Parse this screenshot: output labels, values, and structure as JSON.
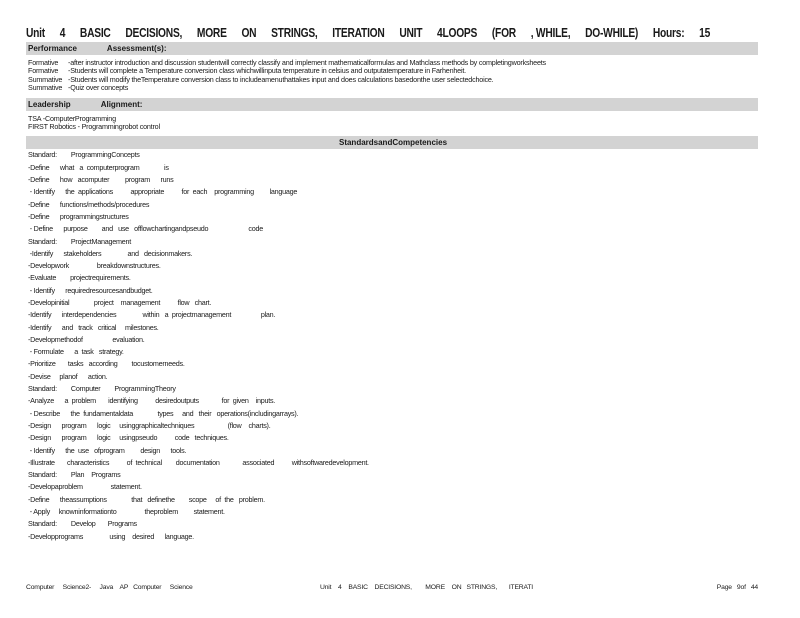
{
  "header": {
    "title_parts": [
      "Unit",
      "4",
      "BASIC",
      "DECISIONS,",
      "MORE",
      "ON",
      "STRINGS,",
      "ITERATION",
      "UNIT",
      "4LOOPS",
      "(FOR",
      ", WHILE,",
      "DO-WHILE)",
      "Hours:",
      "15"
    ],
    "performance_label": "Performance",
    "assessment_label": "Assessment(s):"
  },
  "assessments": [
    {
      "kind": "Formative",
      "text": "-after instructor introduction and discussion studentwill correctly classify and implement mathematicalformulas and Mathclass methods by completingworksheets"
    },
    {
      "kind": "Formative",
      "text": "-Students will complete a Temperature conversion class whichwillinputa temperature in celsius and outputatemperature in Farhenheit."
    },
    {
      "kind": "Summative",
      "text": "-Students will modify theTemperature conversion class to includeamenuthattakes input and does calculations basedonthe user selectedchoice."
    },
    {
      "kind": "Summative",
      "text": "-Quiz over concepts"
    }
  ],
  "leadership": {
    "label": "Leadership",
    "alignment_label": "Alignment:",
    "lines": [
      "TSA -ComputerProgramming",
      "FIRST Robotics - Programmingrobot control"
    ]
  },
  "standards_header": "StandardsandCompetencies",
  "standards_rows": [
    "Standard:        ProgrammingConcepts",
    "-Define      what   a  computerprogram              is",
    "-Define      how   acomputer         program      runs",
    " - Identify      the  applications          appropriate          for  each    programming         language",
    "-Define      functions/methods/procedures",
    "-Define      programmingstructures",
    " - Define      purpose        and   use   offlowchartingandpseudo                       code",
    "Standard:        ProjectManagement",
    " -Identify      stakeholders               and   decisionmakers.",
    "-Developwork                breakdownstructures.",
    "-Evaluate        projectrequirements.",
    " - Identify      requiredresourcesandbudget.",
    "-Developinitial              project    management          flow   chart.",
    "-Identify      interdependencies               within   a  projectmanagement                 plan.",
    "-Identify      and   track   critical     milestones.",
    "-Developmethodof                 evaluation.",
    " - Formulate      a  task   strategy.",
    "-Prioritize       tasks   according        tocustomerneeds.",
    "-Devise     planof      action.",
    "Standard:        Computer        ProgrammingTheory",
    "-Analyze      a  problem       identifying          desiredoutputs             for  given    inputs.",
    " - Describe      the  fundamentaldata              types     and   their   operations(includingarrays).",
    "-Design      program      logic     usinggraphicaltechniques                   (flow    charts).",
    "-Design      program      logic     usingpseudo          code   techniques.",
    " - Identify      the  use   ofprogram         design      tools.",
    "-Illustrate       characteristics          of  technical        documentation             associated          withsoftwaredevelopment.",
    "Standard:        Plan    Programs",
    "-Developaproblem                statement.",
    "-Define      theassumptions              that   definethe        scope     of  the   problem.",
    " - Apply     knowninformationto                theproblem         statement.",
    "Standard:        Develop       Programs",
    "-Developprograms               using    desired      language."
  ],
  "footer": {
    "left": "Computer     Science2-     Java    AP   Computer     Science",
    "middle": "Unit    4    BASIC    DECISIONS,        MORE    ON   STRINGS,       ITERATI",
    "right": "Page   9of   44"
  }
}
